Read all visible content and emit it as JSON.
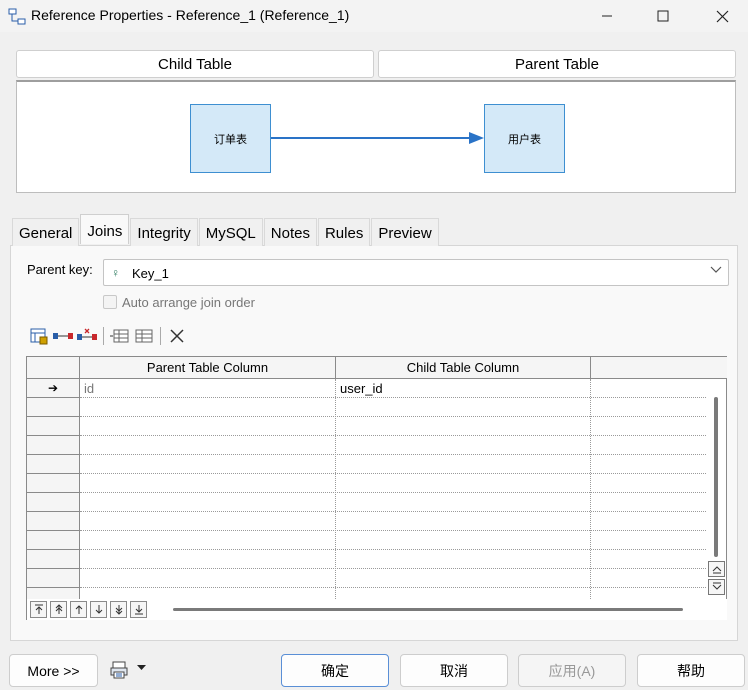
{
  "window": {
    "title": "Reference Properties - Reference_1 (Reference_1)"
  },
  "header_buttons": {
    "child_table": "Child Table",
    "parent_table": "Parent Table"
  },
  "diagram": {
    "child_entity": "订单表",
    "parent_entity": "用户表"
  },
  "tabs": [
    {
      "label": "General",
      "active": false
    },
    {
      "label": "Joins",
      "active": true
    },
    {
      "label": "Integrity",
      "active": false
    },
    {
      "label": "MySQL",
      "active": false
    },
    {
      "label": "Notes",
      "active": false
    },
    {
      "label": "Rules",
      "active": false
    },
    {
      "label": "Preview",
      "active": false
    }
  ],
  "joins": {
    "parent_key_label": "Parent key:",
    "parent_key_value": "Key_1",
    "auto_arrange_label": "Auto arrange join order",
    "auto_arrange_checked": false,
    "columns": [
      "Parent Table Column",
      "Child Table Column"
    ],
    "rows": [
      {
        "parent": "id",
        "child": "user_id"
      }
    ],
    "current_row_marker": "➔"
  },
  "footer": {
    "more": "More >>",
    "ok": "确定",
    "cancel": "取消",
    "apply": "应用(A)",
    "help": "帮助"
  }
}
